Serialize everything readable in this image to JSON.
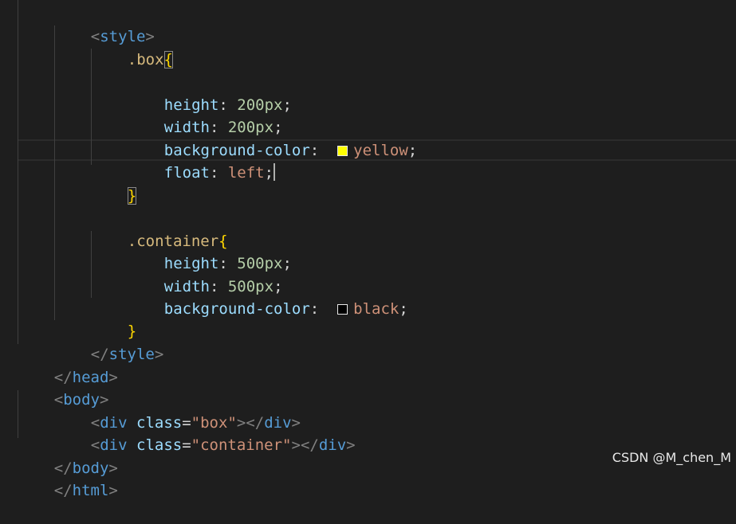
{
  "colors": {
    "background": "#1e1e1e",
    "tag": "#569cd6",
    "tag_bracket": "#808080",
    "attribute": "#9cdcfe",
    "string": "#ce9178",
    "selector": "#d7ba7d",
    "brace": "#ffd700",
    "property": "#9cdcfe",
    "number": "#b5cea8",
    "keyword_value": "#ce9178",
    "swatch_yellow": "#ffff00",
    "swatch_black": "#000000"
  },
  "code": {
    "style_open": {
      "lt": "<",
      "tag": "style",
      "gt": ">"
    },
    "box_rule": {
      "selector": ".box",
      "open": "{",
      "close": "}"
    },
    "box_height": {
      "prop": "height",
      "colon": ": ",
      "value": "200px",
      "semi": ";"
    },
    "box_width": {
      "prop": "width",
      "colon": ": ",
      "value": "200px",
      "semi": ";"
    },
    "box_bg": {
      "prop": "background-color",
      "colon": ": ",
      "swatch": "yellow-color-swatch",
      "value": "yellow",
      "semi": ";"
    },
    "box_float": {
      "prop": "float",
      "colon": ": ",
      "value": "left",
      "semi": ";"
    },
    "container_rule": {
      "selector": ".container",
      "open": "{",
      "close": "}"
    },
    "container_height": {
      "prop": "height",
      "colon": ": ",
      "value": "500px",
      "semi": ";"
    },
    "container_width": {
      "prop": "width",
      "colon": ": ",
      "value": "500px",
      "semi": ";"
    },
    "container_bg": {
      "prop": "background-color",
      "colon": ": ",
      "swatch": "black-color-swatch",
      "value": "black",
      "semi": ";"
    },
    "style_close": {
      "lt": "</",
      "tag": "style",
      "gt": ">"
    },
    "head_close": {
      "lt": "</",
      "tag": "head",
      "gt": ">"
    },
    "body_open": {
      "lt": "<",
      "tag": "body",
      "gt": ">"
    },
    "div_box": {
      "lt": "<",
      "tag": "div",
      "attr": "class",
      "eq": "=",
      "value": "\"box\"",
      "gt": ">",
      "close_lt": "</",
      "close_tag": "div",
      "close_gt": ">"
    },
    "div_container": {
      "lt": "<",
      "tag": "div",
      "attr": "class",
      "eq": "=",
      "value": "\"container\"",
      "gt": ">",
      "close_lt": "</",
      "close_tag": "div",
      "close_gt": ">"
    },
    "body_close": {
      "lt": "</",
      "tag": "body",
      "gt": ">"
    },
    "html_close": {
      "lt": "</",
      "tag": "html",
      "gt": ">"
    }
  },
  "watermark": "CSDN @M_chen_M"
}
